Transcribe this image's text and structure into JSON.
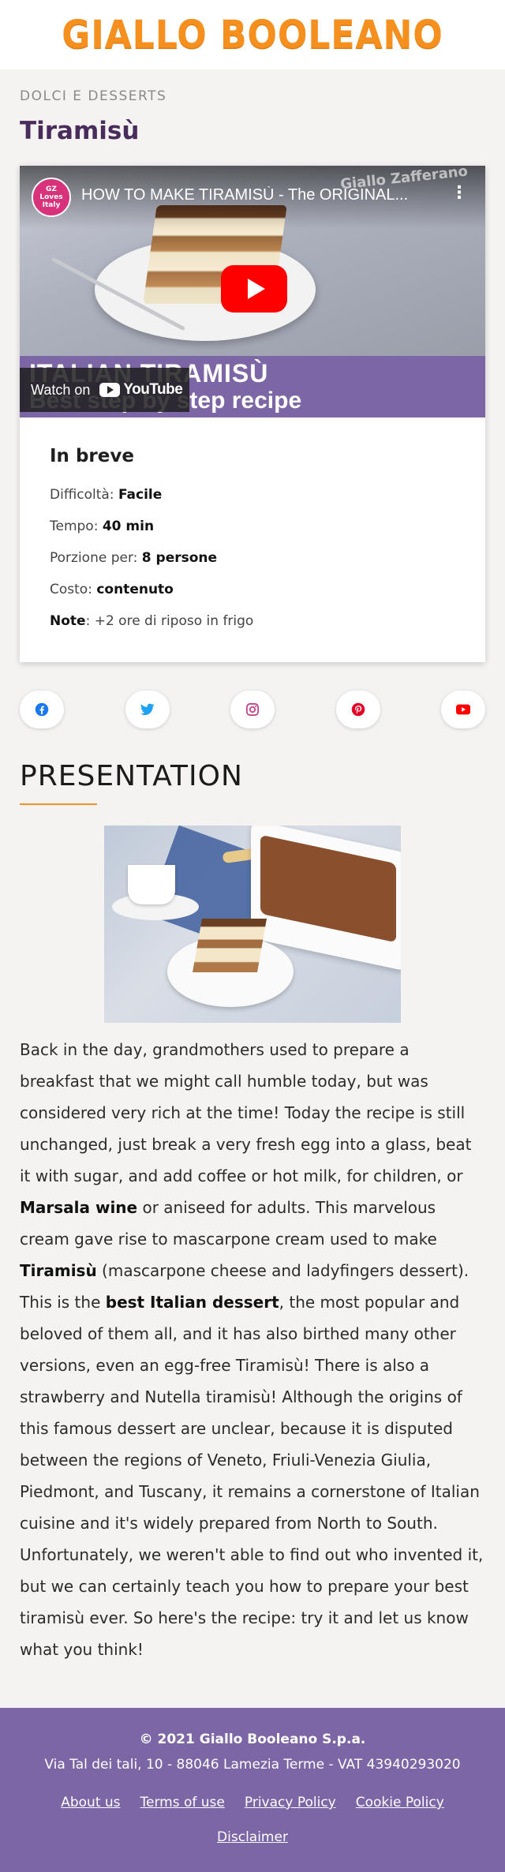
{
  "header": {
    "logo_text": "GIALLO BOOLEANO"
  },
  "category": "DOLCI E DESSERTS",
  "title": "Tiramisù",
  "video": {
    "title": "HOW TO MAKE TIRAMISÙ - The ORIGINAL...",
    "channel_badge": "GZ Loves Italy",
    "watermark": "Giallo Zafferano",
    "banner_line1": "ITALIAN TIRAMISÙ",
    "banner_line2": "Best step by step recipe",
    "watch_on": "Watch on",
    "youtube_label": "YouTube"
  },
  "brief": {
    "title": "In breve",
    "rows": [
      {
        "label": "Difficoltà:",
        "value": "Facile"
      },
      {
        "label": "Tempo:",
        "value": "40 min"
      },
      {
        "label": "Porzione per:",
        "value": "8 persone"
      },
      {
        "label": "Costo:",
        "value": "contenuto"
      }
    ],
    "note_label": "Note",
    "note_value": ": +2 ore di riposo in frigo"
  },
  "social": [
    {
      "name": "facebook-icon",
      "color": "#1877f2"
    },
    {
      "name": "twitter-icon",
      "color": "#1da1f2"
    },
    {
      "name": "instagram-icon",
      "color": "#c13584"
    },
    {
      "name": "pinterest-icon",
      "color": "#e60023"
    },
    {
      "name": "youtube-icon",
      "color": "#ff0000"
    }
  ],
  "section": {
    "title": "PRESENTATION"
  },
  "article": {
    "p1": "Back in the day, grandmothers used to prepare a breakfast that we might call humble today, but was considered very rich at the time! Today the recipe is still unchanged, just break a very fresh egg into a glass, beat it with sugar, and add coffee or hot milk, for children, or ",
    "b1": "Marsala wine",
    "p2": " or aniseed for adults. This marvelous cream gave rise to mascarpone cream used to make ",
    "b2": "Tiramisù",
    "p3": " (mascarpone cheese and ladyfingers dessert). This is the ",
    "b3": "best Italian dessert",
    "p4": ", the most popular and beloved of them all, and it has also birthed many other versions, even an egg-free Tiramisù! There is also a strawberry and Nutella tiramisù! Although the origins of this famous dessert are unclear, because it is disputed between the regions of Veneto, Friuli-Venezia Giulia, Piedmont, and Tuscany, it remains a cornerstone of Italian cuisine and it's widely prepared from North to South. Unfortunately, we weren't able to find out who invented it, but we can certainly teach you how to prepare your best tiramisù ever. So here's the recipe: try it and let us know what you think!"
  },
  "footer": {
    "copyright": "© 2021 Giallo Booleano S.p.a.",
    "address": "Via Tal dei tali, 10 - 88046 Lamezia Terme - VAT 43940293020",
    "links": [
      "About us",
      "Terms of use",
      "Privacy Policy",
      "Cookie Policy",
      "Disclaimer"
    ]
  },
  "colors": {
    "brand_orange": "#f5901e",
    "brand_purple": "#7d66a5",
    "title_purple": "#4a2c5c"
  }
}
